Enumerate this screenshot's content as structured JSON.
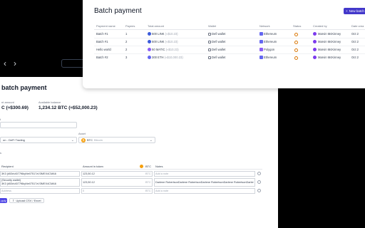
{
  "colors": {
    "accent": "#4338ca",
    "status_pending": "#d97706",
    "avatar": "#7c3aed",
    "link_token": "#3b5bdb",
    "eth_token": "#6366f1",
    "matic_token": "#8b5cf6",
    "btc": "#f59e0b"
  },
  "nav": {
    "prev_icon": "chevron-left-icon",
    "next_icon": "chevron-right-icon"
  },
  "create_form": {
    "title": "batch payment",
    "amount_label": "nt amount",
    "amount_value": "C (≈$300.69)",
    "balance_label": "Available balance",
    "balance_value": "1,234.12 BTC (≈$52,000.23)",
    "field_a_label": "t",
    "wallet_value": "on - DeFi Trading",
    "asset_label": "Asset",
    "asset_symbol": "BTC",
    "asset_name": "Bitcoin",
    "section_label": "s",
    "columns": {
      "recipient": "Recipient",
      "amount": "Amount in token",
      "token": "BTC",
      "notes": "Notes"
    },
    "rows": [
      {
        "recipient": "3K3 (#53rk4077f6kyNe07517zV3MEX4CMA6",
        "amount": "123,50.12",
        "token": "BTC",
        "notes": "Add a note"
      },
      {
        "recipient_name": "(Security wallet)",
        "recipient": "3K3 (#53rk4077f6kyNe07517zV3MEX4CMA6",
        "amount": "123,50.12",
        "token": "BTC",
        "notes": "Darlene RobertsonDarlene RobertsonDarlene RobertsonDarlene RobertsonDarlen"
      },
      {
        "recipient": "Address",
        "amount": "0",
        "token": "BTC",
        "notes": "Add a note"
      }
    ],
    "apply_label": "pply",
    "upload_label": "Upload CSV / Excel"
  },
  "batch_list": {
    "title": "Batch payment",
    "new_button": "New batch",
    "columns": [
      "Payment name",
      "Payees",
      "Total amount",
      "Wallet",
      "Network",
      "Status",
      "Created by",
      "Date crea"
    ],
    "rows": [
      {
        "name": "Batch #1",
        "payees": "1",
        "amount": "500 LINK",
        "usd": "(≈$10.23)",
        "token": "link",
        "wallet": "Defi wallet",
        "network": "Ethereum",
        "net": "eth",
        "created_by": "Marvin McKinney",
        "date": "Oct 2"
      },
      {
        "name": "Batch #1",
        "payees": "2",
        "amount": "500 LINK",
        "usd": "(≈$10.23)",
        "token": "link",
        "wallet": "Defi wallet",
        "network": "Ethereum",
        "net": "eth",
        "created_by": "Marvin McKinney",
        "date": "Oct 2"
      },
      {
        "name": "Hello world",
        "payees": "2",
        "amount": "50 MATIC",
        "usd": "(≈$10.23)",
        "token": "matic",
        "wallet": "Defi wallet",
        "network": "Polygon",
        "net": "poly",
        "created_by": "Marvin McKinney",
        "date": "Oct 2"
      },
      {
        "name": "Batch #2",
        "payees": "3",
        "amount": "300 ETH",
        "usd": "(≈$10,000.23)",
        "token": "eth",
        "wallet": "Defi wallet",
        "network": "Ethereum",
        "net": "eth",
        "created_by": "Marvin McKinney",
        "date": "Oct 2"
      }
    ]
  }
}
